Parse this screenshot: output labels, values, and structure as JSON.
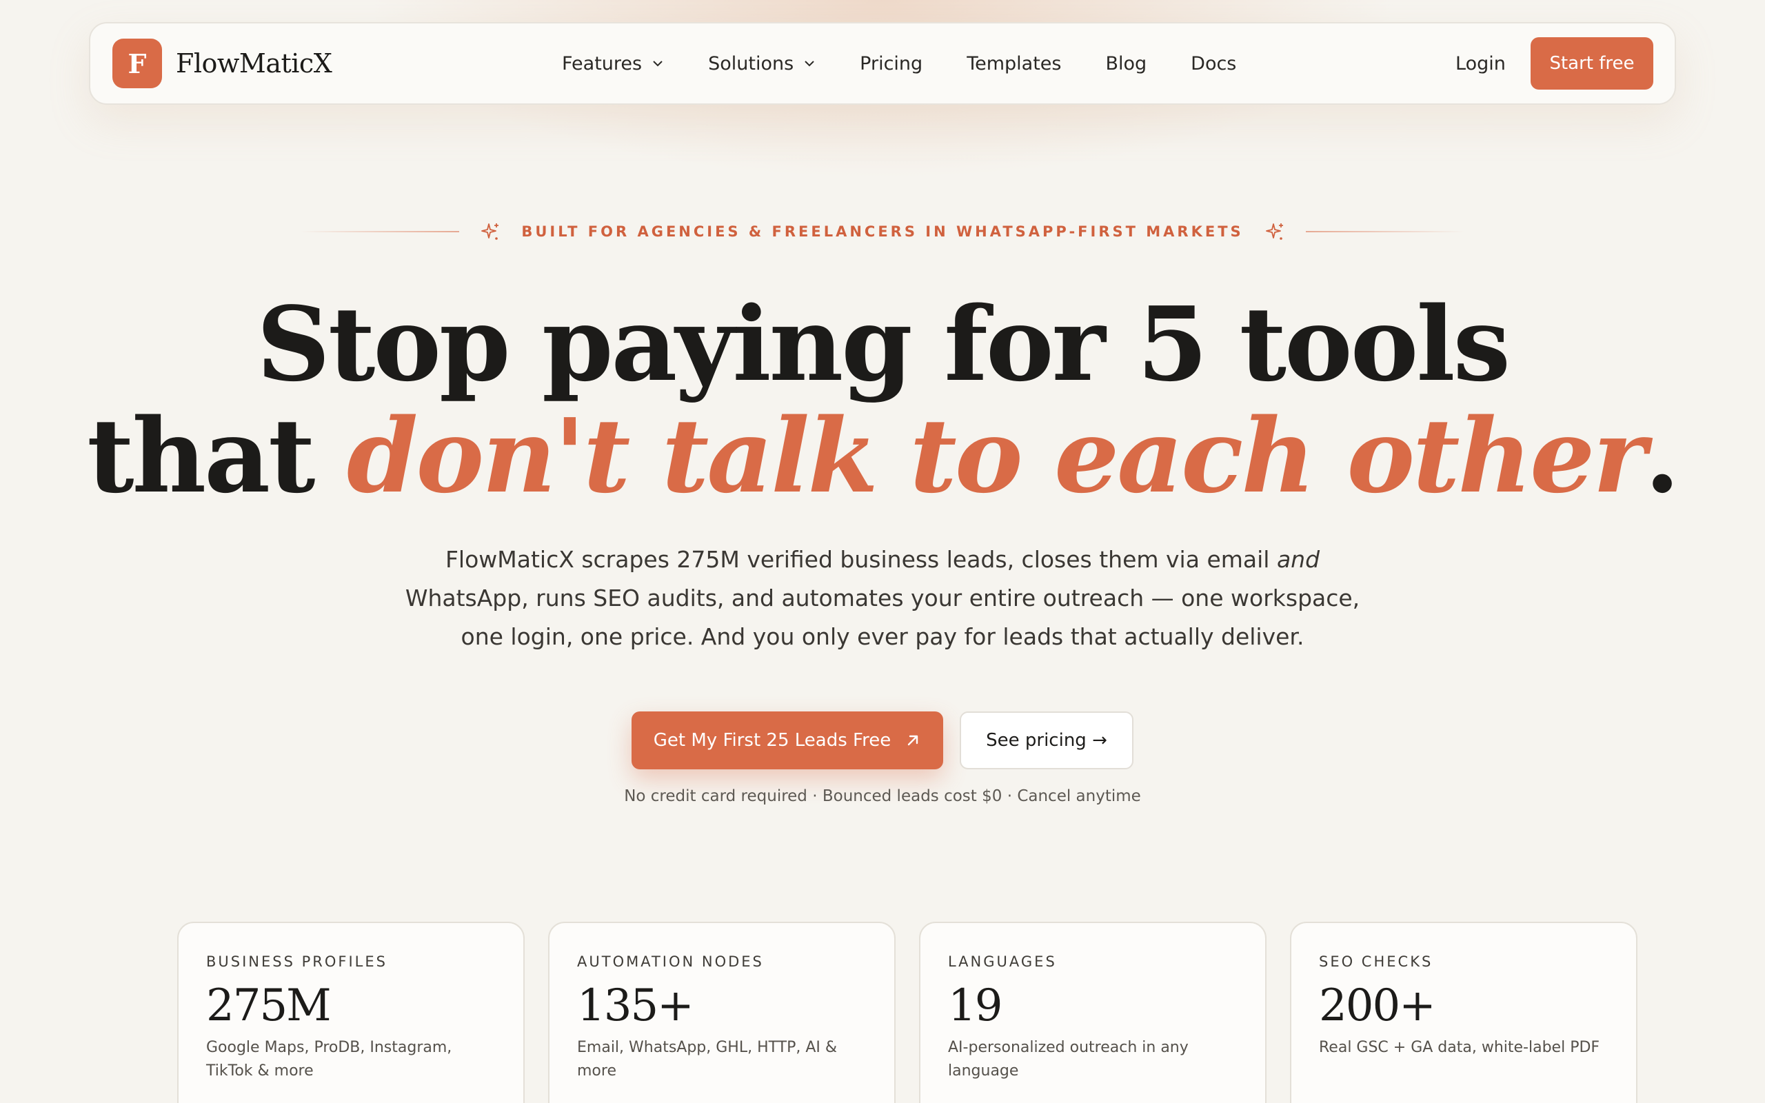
{
  "brand": {
    "logo_letter": "F",
    "name": "FlowMaticX",
    "accent_color": "#d96b47"
  },
  "nav": {
    "items": [
      {
        "label": "Features",
        "dropdown": true
      },
      {
        "label": "Solutions",
        "dropdown": true
      },
      {
        "label": "Pricing",
        "dropdown": false
      },
      {
        "label": "Templates",
        "dropdown": false
      },
      {
        "label": "Blog",
        "dropdown": false
      },
      {
        "label": "Docs",
        "dropdown": false
      }
    ],
    "login": "Login",
    "start": "Start free"
  },
  "hero": {
    "eyebrow": "BUILT FOR AGENCIES & FREELANCERS IN WHATSAPP-FIRST MARKETS",
    "headline_line1": "Stop paying for 5 tools",
    "headline_line2_start": "that ",
    "headline_accent": "don't talk to each other",
    "headline_end": ".",
    "sub_part1": "FlowMaticX scrapes 275M verified business leads, closes them via email ",
    "sub_em": "and",
    "sub_part2": " WhatsApp, runs SEO audits, and automates your entire outreach — one workspace, one login, one price. And you only ever pay for leads that actually deliver.",
    "cta_primary": "Get My First 25 Leads Free",
    "cta_secondary": "See pricing →",
    "fineprint": "No credit card required · Bounced leads cost $0 · Cancel anytime"
  },
  "stats": [
    {
      "label": "BUSINESS PROFILES",
      "value": "275M",
      "desc": "Google Maps, ProDB, Instagram, TikTok & more"
    },
    {
      "label": "AUTOMATION NODES",
      "value": "135+",
      "desc": "Email, WhatsApp, GHL, HTTP, AI & more"
    },
    {
      "label": "LANGUAGES",
      "value": "19",
      "desc": "AI-personalized outreach in any language"
    },
    {
      "label": "SEO CHECKS",
      "value": "200+",
      "desc": "Real GSC + GA data, white-label PDF"
    }
  ],
  "icons": {
    "chevron": "chevron-down-icon",
    "sparkle": "sparkle-icon",
    "arrow": "arrow-up-right-icon"
  }
}
